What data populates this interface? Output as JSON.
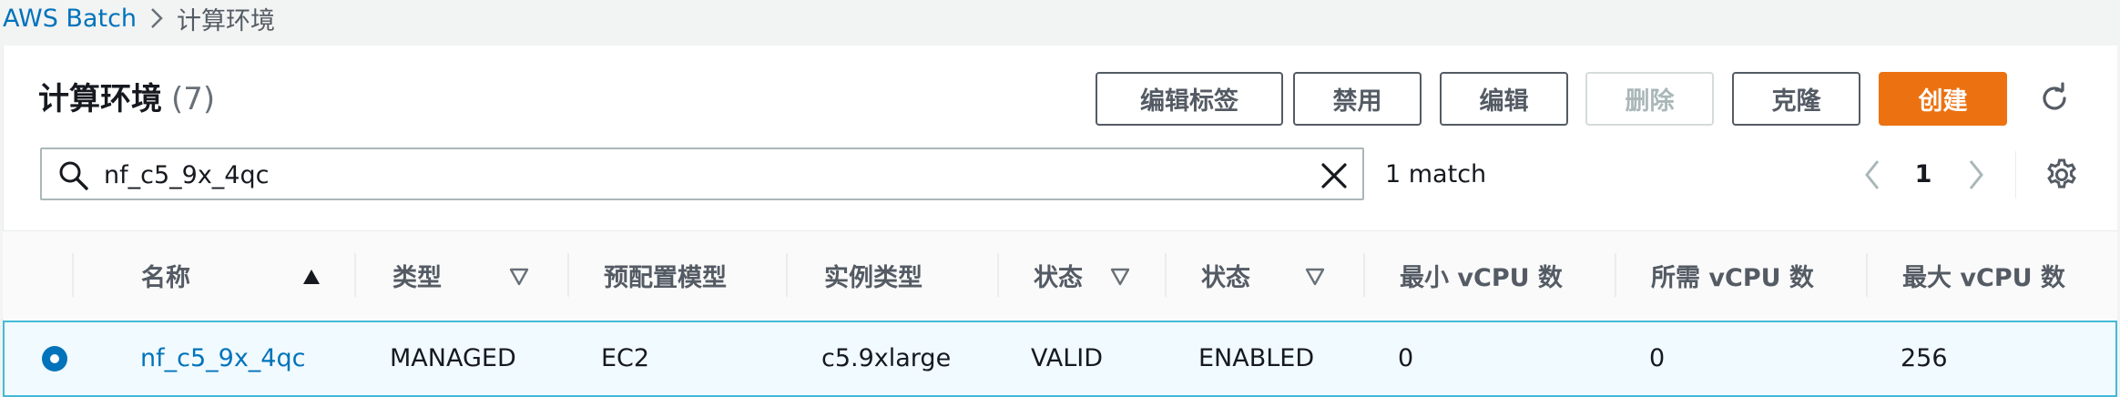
{
  "breadcrumb": {
    "root": "AWS Batch",
    "current": "计算环境"
  },
  "header": {
    "title": "计算环境",
    "count": "(7)"
  },
  "actions": {
    "edit_tags": "编辑标签",
    "disable": "禁用",
    "edit": "编辑",
    "delete": "删除",
    "clone": "克隆",
    "create": "创建"
  },
  "search": {
    "value": "nf_c5_9x_4qc",
    "match_text": "1 match"
  },
  "pagination": {
    "current_page": "1"
  },
  "table": {
    "columns": [
      "名称",
      "类型",
      "预配置模型",
      "实例类型",
      "状态",
      "状态",
      "最小 vCPU 数",
      "所需 vCPU 数",
      "最大 vCPU 数"
    ],
    "rows": [
      {
        "name": "nf_c5_9x_4qc",
        "type": "MANAGED",
        "provisioning": "EC2",
        "instance_type": "c5.9xlarge",
        "state": "VALID",
        "status": "ENABLED",
        "min_vcpu": "0",
        "desired_vcpu": "0",
        "max_vcpu": "256",
        "selected": true
      }
    ]
  },
  "colors": {
    "link": "#0073bb",
    "primary": "#ec7211",
    "selected_row_bg": "#f1faff",
    "selected_row_border": "#44b9d6"
  },
  "icons": [
    "chevron-right-icon",
    "search-icon",
    "close-icon",
    "refresh-icon",
    "chevron-left-icon",
    "settings-icon",
    "sort-ascending-icon",
    "sort-descending-icon"
  ]
}
